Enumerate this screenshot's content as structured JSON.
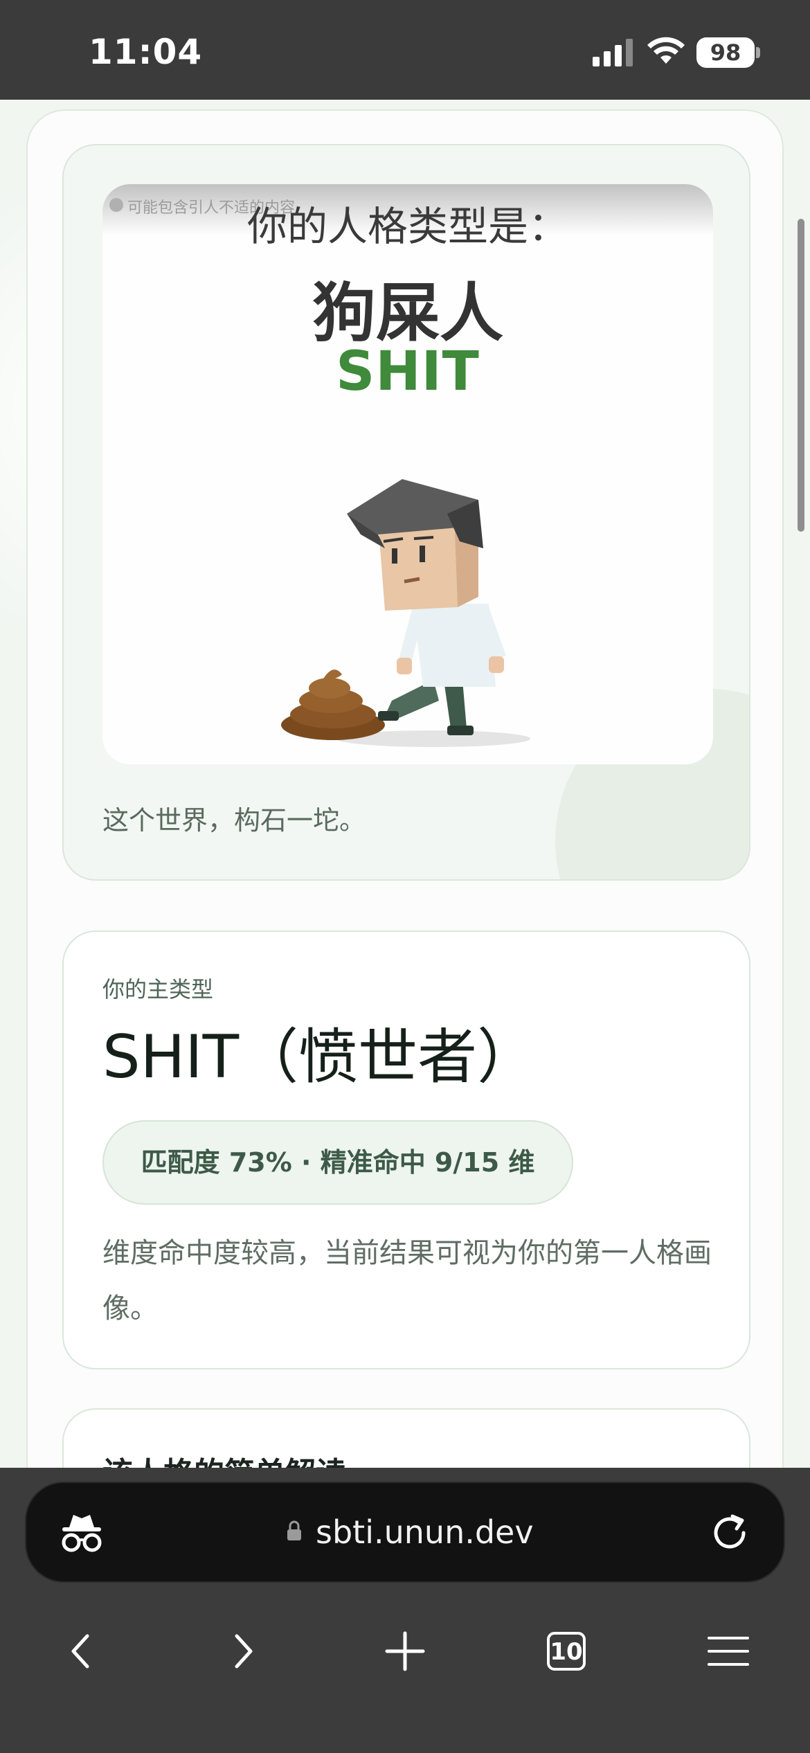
{
  "status_bar": {
    "time": "11:04",
    "battery": "98"
  },
  "poster": {
    "caution": "可能包含引人不适的内容",
    "heading": "你的人格类型是：",
    "name": "狗屎人",
    "code": "SHIT"
  },
  "tagline": "这个世界，构石一坨。",
  "main_type": {
    "label": "你的主类型",
    "name": "SHIT（愤世者）",
    "match": "匹配度 73% · 精准命中 9/15 维",
    "description": "维度命中度较高，当前结果可视为你的第一人格画像。"
  },
  "interpretation": {
    "title": "该人格的简单解读"
  },
  "browser": {
    "url": "sbti.unun.dev",
    "tabs_count": "10"
  },
  "colors": {
    "accent_green": "#3f8a3b",
    "page_bg": "#f1f6f1",
    "chrome_bg": "#3c3c3c"
  }
}
